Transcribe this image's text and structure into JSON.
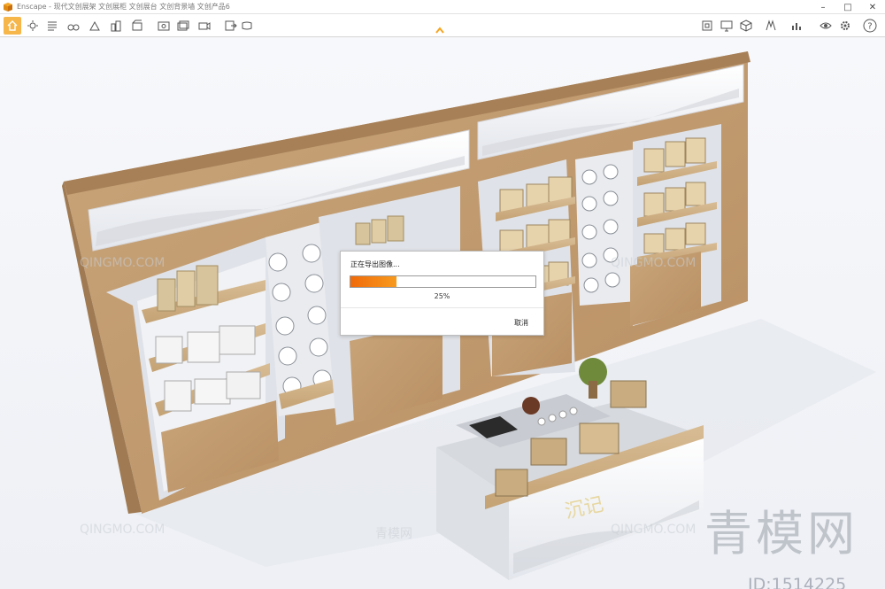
{
  "window": {
    "title": "Enscape - 现代文创展架 文创展柜 文创展台 文创背景墙 文创产品6"
  },
  "toolbar": {
    "icons": [
      "home-icon",
      "sun-icon",
      "settings-list-icon",
      "binoculars-icon",
      "buildings-icon",
      "box-icon",
      "screenshot-icon",
      "video-icon",
      "panorama-icon",
      "export-icon",
      "monitor-icon",
      "image-icon",
      "cube-icon",
      "material-icon",
      "chart-icon",
      "view-icon",
      "gear-icon",
      "help-icon"
    ],
    "accent_color": "#f6b64a"
  },
  "dialog": {
    "title": "正在导出图像...",
    "progress": 0.25,
    "progress_text": "25%",
    "cancel_label": "取消",
    "progress_color": "#f07a10"
  },
  "watermark": {
    "site": "QINGMO.COM",
    "site_cn": "青模网",
    "big": "青模网",
    "id": "ID:1514225"
  },
  "scene": {
    "table_sign": "沉记"
  }
}
